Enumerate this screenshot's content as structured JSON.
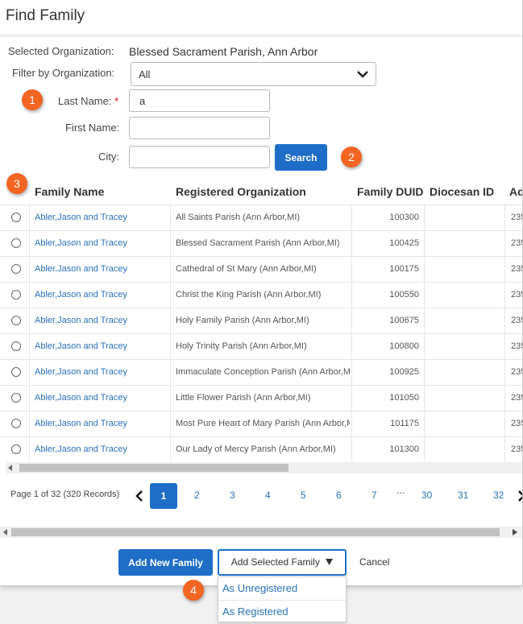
{
  "dialog": {
    "title": "Find Family"
  },
  "form": {
    "selected_org_label": "Selected Organization:",
    "selected_org_value": "Blessed Sacrament Parish, Ann Arbor",
    "filter_label": "Filter by Organization:",
    "filter_value": "All",
    "last_name_label": "Last Name:",
    "last_name_required": "*",
    "last_name_value": "a",
    "first_name_label": "First Name:",
    "first_name_value": "",
    "city_label": "City:",
    "city_value": "",
    "search_label": "Search"
  },
  "callouts": [
    "1",
    "2",
    "3",
    "4"
  ],
  "grid": {
    "columns": [
      "Family Name",
      "Registered Organization",
      "Family DUID",
      "Diocesan ID",
      "Ad"
    ],
    "rows": [
      {
        "name": "Abler,Jason and Tracey",
        "org": "All Saints Parish (Ann Arbor,MI)",
        "duid": "100300",
        "diocesan": "",
        "addr": "235"
      },
      {
        "name": "Abler,Jason and Tracey",
        "org": "Blessed Sacrament Parish (Ann Arbor,MI)",
        "duid": "100425",
        "diocesan": "",
        "addr": "235"
      },
      {
        "name": "Abler,Jason and Tracey",
        "org": "Cathedral of St Mary (Ann Arbor,MI)",
        "duid": "100175",
        "diocesan": "",
        "addr": "235"
      },
      {
        "name": "Abler,Jason and Tracey",
        "org": "Christ the King Parish (Ann Arbor,MI)",
        "duid": "100550",
        "diocesan": "",
        "addr": "235"
      },
      {
        "name": "Abler,Jason and Tracey",
        "org": "Holy Family Parish (Ann Arbor,MI)",
        "duid": "100675",
        "diocesan": "",
        "addr": "235"
      },
      {
        "name": "Abler,Jason and Tracey",
        "org": "Holy Trinity Parish (Ann Arbor,MI)",
        "duid": "100800",
        "diocesan": "",
        "addr": "235"
      },
      {
        "name": "Abler,Jason and Tracey",
        "org": "Immaculate Conception Parish (Ann Arbor,MI)",
        "duid": "100925",
        "diocesan": "",
        "addr": "235"
      },
      {
        "name": "Abler,Jason and Tracey",
        "org": "Little Flower Parish (Ann Arbor,MI)",
        "duid": "101050",
        "diocesan": "",
        "addr": "235"
      },
      {
        "name": "Abler,Jason and Tracey",
        "org": "Most Pure Heart of Mary Parish (Ann Arbor,MI)",
        "duid": "101175",
        "diocesan": "",
        "addr": "235"
      },
      {
        "name": "Abler,Jason and Tracey",
        "org": "Our Lady of Mercy Parish (Ann Arbor,MI)",
        "duid": "101300",
        "diocesan": "",
        "addr": "235"
      }
    ]
  },
  "pager": {
    "summary": "Page 1 of 32 (320 Records)",
    "pages": [
      "1",
      "2",
      "3",
      "4",
      "5",
      "6",
      "7",
      "...",
      "30",
      "31",
      "32"
    ]
  },
  "footer": {
    "add_new": "Add New Family",
    "add_selected": "Add Selected Family",
    "cancel": "Cancel",
    "menu": [
      "As Unregistered",
      "As Registered"
    ]
  },
  "colors": {
    "accent": "#1e6ec7",
    "callout": "#f26522",
    "link": "#2a6fba"
  }
}
